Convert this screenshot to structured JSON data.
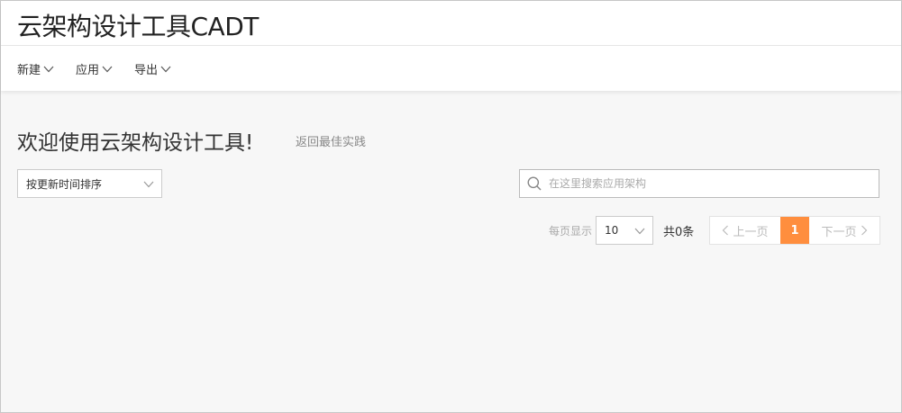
{
  "header": {
    "title": "云架构设计工具CADT",
    "menu": [
      {
        "label": "新建"
      },
      {
        "label": "应用"
      },
      {
        "label": "导出"
      }
    ]
  },
  "main": {
    "welcome": "欢迎使用云架构设计工具!",
    "back_link": "返回最佳实践",
    "sort": {
      "selected": "按更新时间排序"
    },
    "search": {
      "placeholder": "在这里搜索应用架构",
      "value": ""
    },
    "pager": {
      "per_page_label": "每页显示",
      "page_size": "10",
      "total": "共0条",
      "prev": "上一页",
      "current": "1",
      "next": "下一页"
    }
  },
  "colors": {
    "accent": "#ff8e3e",
    "background": "#f7f7f7"
  },
  "icons": {
    "dropdown": "chevron-down-icon",
    "search": "search-icon",
    "prev": "chevron-left-icon",
    "next": "chevron-right-icon"
  }
}
